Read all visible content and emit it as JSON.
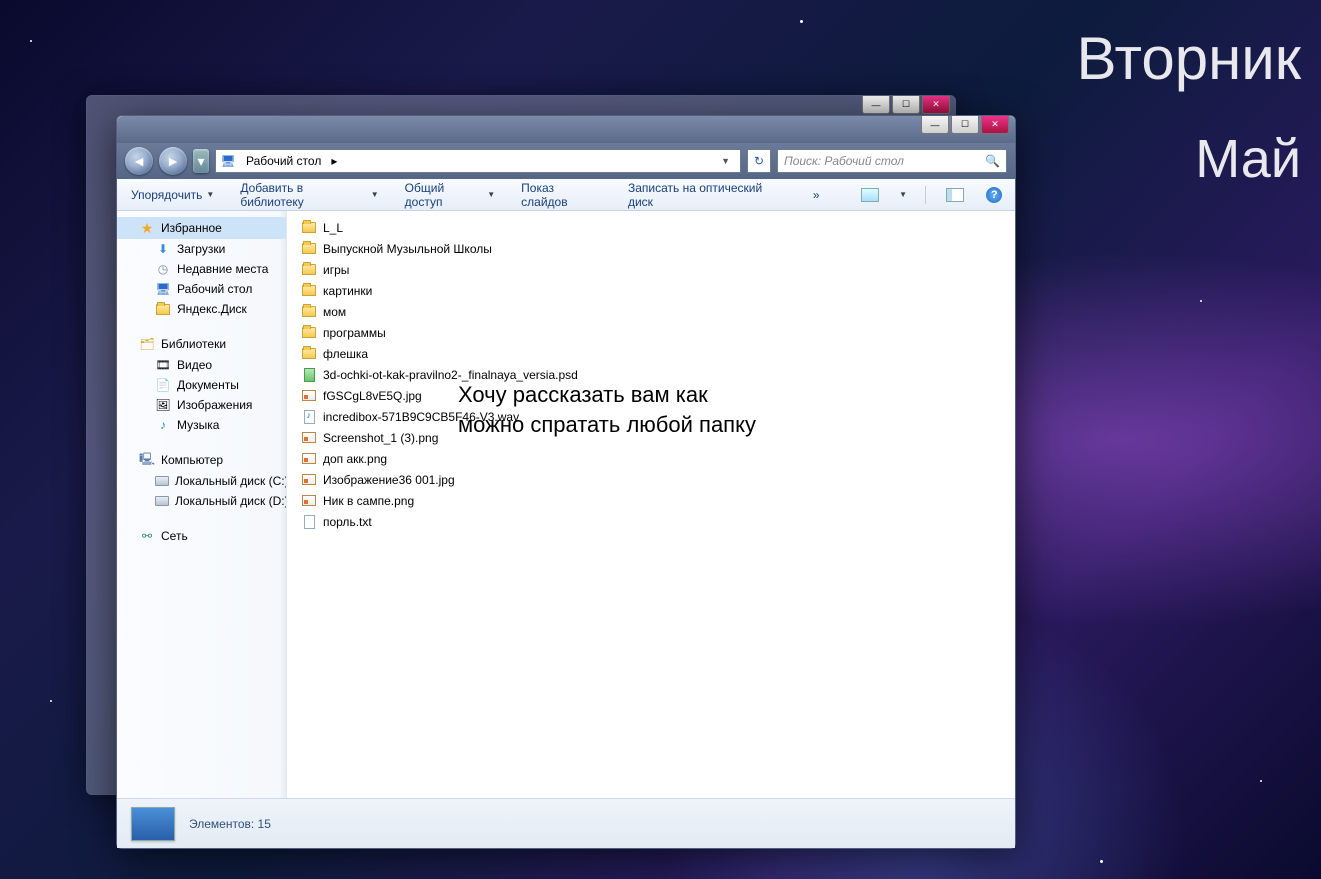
{
  "desktop": {
    "day": "Вторник",
    "month": "Май"
  },
  "address": {
    "location": "Рабочий стол",
    "dropdown_arrow": "▸",
    "search_placeholder": "Поиск: Рабочий стол"
  },
  "toolbar": {
    "organize": "Упорядочить",
    "add_to_library": "Добавить в библиотеку",
    "share": "Общий доступ",
    "slideshow": "Показ слайдов",
    "burn": "Записать на оптический диск",
    "overflow": "»"
  },
  "sidebar": {
    "favorites": {
      "header": "Избранное",
      "items": [
        "Загрузки",
        "Недавние места",
        "Рабочий стол",
        "Яндекс.Диск"
      ]
    },
    "libraries": {
      "header": "Библиотеки",
      "items": [
        "Видео",
        "Документы",
        "Изображения",
        "Музыка"
      ]
    },
    "computer": {
      "header": "Компьютер",
      "items": [
        "Локальный диск (C:)",
        "Локальный диск (D:)"
      ]
    },
    "network": {
      "header": "Сеть"
    }
  },
  "files": {
    "folders": [
      "L_L",
      "Выпускной Музыльной Школы",
      "игры",
      "картинки",
      "мом",
      "программы",
      "флешка"
    ],
    "items": [
      {
        "name": "3d-ochki-ot-kak-pravilno2-_finalnaya_versia.psd",
        "type": "psd"
      },
      {
        "name": "fGSCgL8vE5Q.jpg",
        "type": "img"
      },
      {
        "name": "incredibox-571B9C9CB5F46-V3.wav",
        "type": "wav"
      },
      {
        "name": "Screenshot_1 (3).png",
        "type": "img"
      },
      {
        "name": "доп акк.png",
        "type": "img"
      },
      {
        "name": "Изображение36 001.jpg",
        "type": "img"
      },
      {
        "name": "Ник в сампе.png",
        "type": "img"
      },
      {
        "name": "порль.txt",
        "type": "file"
      }
    ]
  },
  "overlay_annotation": "Хочу рассказать вам как можно спратать любой папку",
  "statusbar": {
    "count_label": "Элементов: 15"
  }
}
